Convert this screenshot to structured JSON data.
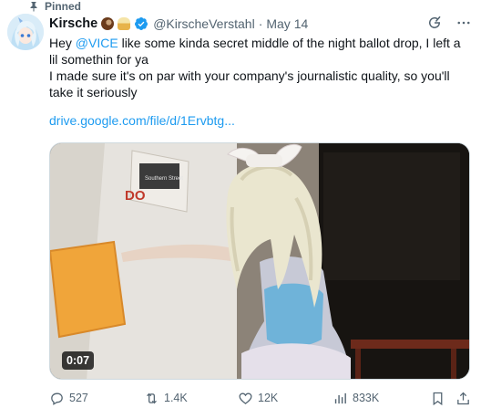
{
  "pinned": {
    "label": "Pinned"
  },
  "author": {
    "display_name": "Kirsche",
    "emojis": [
      "coconut-emoji",
      "cupcake-emoji"
    ],
    "verified": true,
    "handle": "@KirscheVerstahl",
    "separator": "·",
    "date": "May 14"
  },
  "tweet": {
    "text_before_mention": "Hey ",
    "mention": "@VICE",
    "text_after_mention": " like some kinda secret middle of the night ballot drop, I left a lil somethin for ya",
    "line2": "I made sure it's on par with your company's journalistic quality, so you'll take it seriously",
    "link": "drive.google.com/file/d/1Ervbtg..."
  },
  "media": {
    "type": "video",
    "duration": "0:07",
    "sign_text": "DO",
    "sign_small_text": "Southern Street"
  },
  "actions": {
    "replies": "527",
    "reposts": "1.4K",
    "likes": "12K",
    "views": "833K"
  },
  "colors": {
    "accent": "#1d9bf0",
    "secondary_text": "#536471",
    "primary_text": "#0f1419",
    "verified": "#1d9bf0"
  },
  "icons": [
    "pin-icon",
    "verified-icon",
    "grok-icon",
    "more-icon",
    "reply-icon",
    "repost-icon",
    "like-icon",
    "views-icon",
    "bookmark-icon",
    "share-icon"
  ]
}
